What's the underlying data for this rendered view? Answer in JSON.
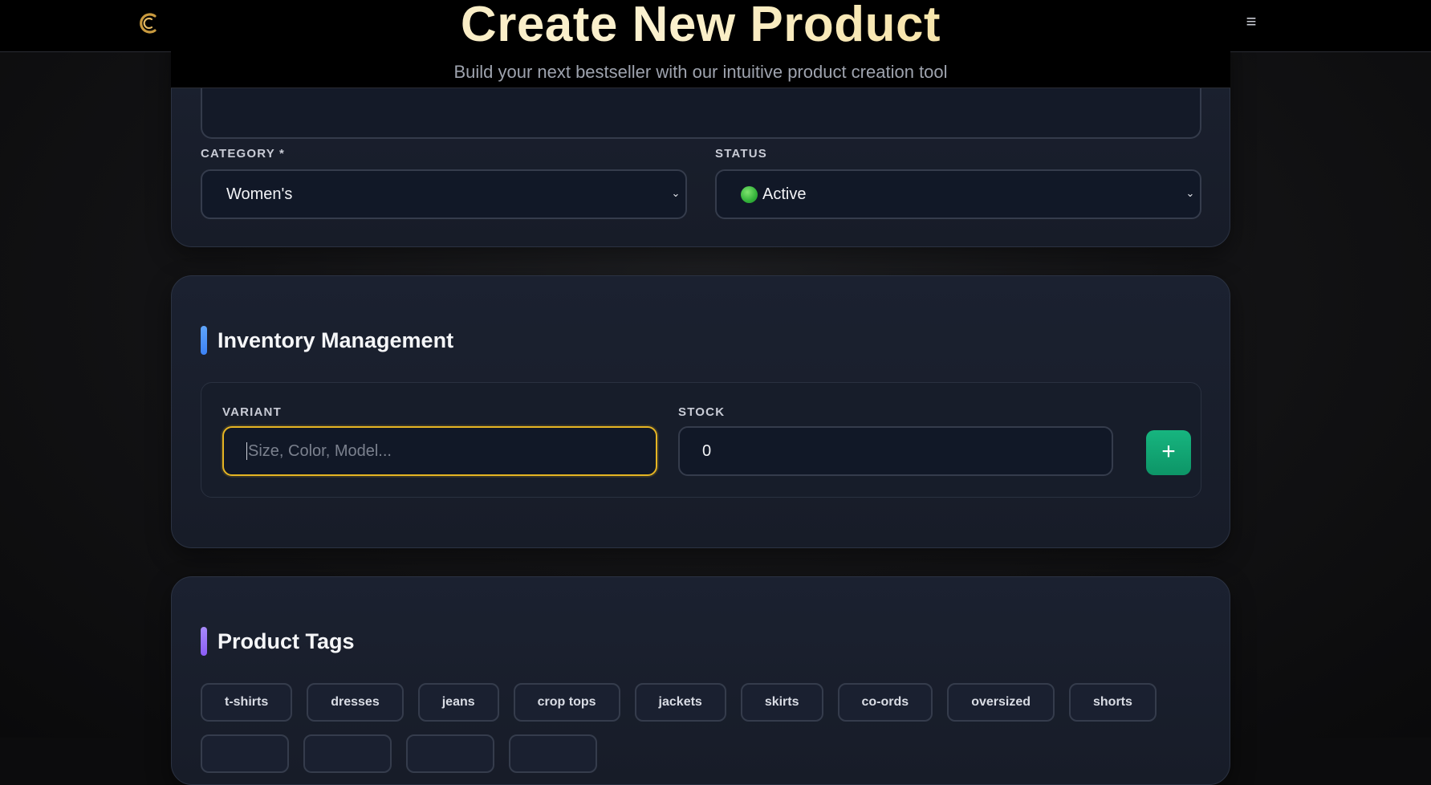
{
  "header": {
    "logo_icon": "brand-c-logo",
    "menu_icon": "hamburger-menu-icon"
  },
  "hero": {
    "title": "Create New Product",
    "subtitle": "Build your next bestseller with our intuitive product creation tool"
  },
  "basic_info": {
    "category_label": "CATEGORY *",
    "category_value": "Women's",
    "status_label": "STATUS",
    "status_value": "Active",
    "status_color": "#33b23a"
  },
  "inventory": {
    "title": "Inventory Management",
    "accent_color": "#3b82f6",
    "variant_label": "VARIANT",
    "variant_placeholder": "Size, Color, Model...",
    "stock_label": "STOCK",
    "stock_value": "0",
    "add_button_label": "+"
  },
  "tags": {
    "title": "Product Tags",
    "accent_color": "#8b5cf6",
    "items": [
      "t-shirts",
      "dresses",
      "jeans",
      "crop tops",
      "jackets",
      "skirts",
      "co-ords",
      "oversized",
      "shorts"
    ]
  }
}
